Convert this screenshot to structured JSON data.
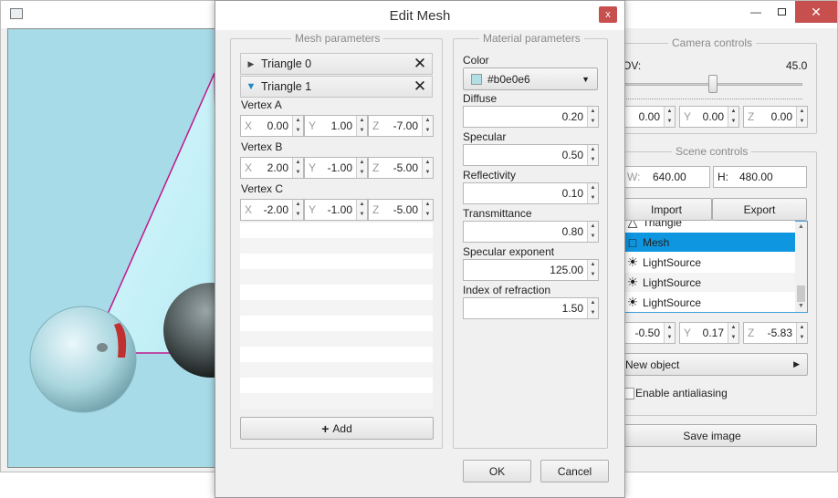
{
  "dialog": {
    "title": "Edit Mesh",
    "mesh_group_title": "Mesh parameters",
    "material_group_title": "Material parameters",
    "triangles": [
      {
        "name": "Triangle 0",
        "expanded": false
      },
      {
        "name": "Triangle 1",
        "expanded": true
      }
    ],
    "vertices": [
      {
        "label": "Vertex A",
        "x": "0.00",
        "y": "1.00",
        "z": "-7.00"
      },
      {
        "label": "Vertex B",
        "x": "2.00",
        "y": "-1.00",
        "z": "-5.00"
      },
      {
        "label": "Vertex C",
        "x": "-2.00",
        "y": "-1.00",
        "z": "-5.00"
      }
    ],
    "axis_labels": {
      "x": "X",
      "y": "Y",
      "z": "Z"
    },
    "add_label": "Add",
    "add_icon": "plus-icon",
    "material": {
      "color_label": "Color",
      "color_value": "#b0e0e6",
      "fields": [
        {
          "label": "Diffuse",
          "value": "0.20"
        },
        {
          "label": "Specular",
          "value": "0.50"
        },
        {
          "label": "Reflectivity",
          "value": "0.10"
        },
        {
          "label": "Transmittance",
          "value": "0.80"
        },
        {
          "label": "Specular exponent",
          "value": "125.00"
        },
        {
          "label": "Index of refraction",
          "value": "1.50"
        }
      ]
    },
    "ok_label": "OK",
    "cancel_label": "Cancel",
    "close_label": "x"
  },
  "main": {
    "camera_group_title": "Camera controls",
    "fov_label": "OV:",
    "fov_value": "45.0",
    "fov_level": 0.5,
    "camera_pos": {
      "x": "0.00",
      "y": "0.00",
      "z": "0.00"
    },
    "scene_group_title": "Scene controls",
    "width_label": "W:",
    "width_value": "640.00",
    "height_label": "H:",
    "height_value": "480.00",
    "import_label": "Import",
    "export_label": "Export",
    "scene_items": [
      {
        "label": "Triangle",
        "icon": "triangle-icon",
        "selected": false
      },
      {
        "label": "Mesh",
        "icon": "mesh-icon",
        "selected": true
      },
      {
        "label": "LightSource",
        "icon": "light-icon",
        "selected": false
      },
      {
        "label": "LightSource",
        "icon": "light-icon",
        "selected": false
      },
      {
        "label": "LightSource",
        "icon": "light-icon",
        "selected": false
      }
    ],
    "object_pos": {
      "x": "-0.50",
      "y": "0.17",
      "z": "-5.83"
    },
    "new_object_label": "New object",
    "antialiasing_label": "Enable antialiasing",
    "antialiasing_checked": false,
    "save_image_label": "Save image"
  },
  "colors": {
    "accent": "#0f96e0",
    "close_red": "#c7504f",
    "viewport_bg": "#a7dbe8",
    "mesh_edge": "#c0188c"
  }
}
